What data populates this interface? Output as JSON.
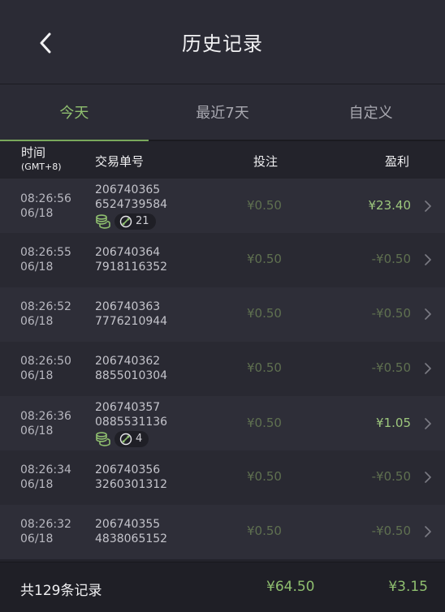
{
  "header": {
    "title": "历史记录",
    "back_icon": "chevron-left-icon"
  },
  "tabs": [
    {
      "label": "今天",
      "active": true
    },
    {
      "label": "最近7天",
      "active": false
    },
    {
      "label": "自定义",
      "active": false
    }
  ],
  "columns": {
    "time": "时间",
    "time_zone": "(GMT+8)",
    "order": "交易单号",
    "bet": "投注",
    "profit": "盈利"
  },
  "rows": [
    {
      "time": "08:26:56",
      "date": "06/18",
      "order1": "206740365",
      "order2": "6524739584",
      "bet": "¥0.50",
      "profit": "¥23.40",
      "win": true,
      "badge": "21"
    },
    {
      "time": "08:26:55",
      "date": "06/18",
      "order1": "206740364",
      "order2": "7918116352",
      "bet": "¥0.50",
      "profit": "-¥0.50",
      "win": false
    },
    {
      "time": "08:26:52",
      "date": "06/18",
      "order1": "206740363",
      "order2": "7776210944",
      "bet": "¥0.50",
      "profit": "-¥0.50",
      "win": false
    },
    {
      "time": "08:26:50",
      "date": "06/18",
      "order1": "206740362",
      "order2": "8855010304",
      "bet": "¥0.50",
      "profit": "-¥0.50",
      "win": false
    },
    {
      "time": "08:26:36",
      "date": "06/18",
      "order1": "206740357",
      "order2": "0885531136",
      "bet": "¥0.50",
      "profit": "¥1.05",
      "win": true,
      "badge": "4"
    },
    {
      "time": "08:26:34",
      "date": "06/18",
      "order1": "206740356",
      "order2": "3260301312",
      "bet": "¥0.50",
      "profit": "-¥0.50",
      "win": false
    },
    {
      "time": "08:26:32",
      "date": "06/18",
      "order1": "206740355",
      "order2": "4838065152",
      "bet": "¥0.50",
      "profit": "-¥0.50",
      "win": false
    }
  ],
  "footer": {
    "total_label": "共129条记录",
    "total_bet": "¥64.50",
    "total_profit": "¥3.15"
  },
  "colors": {
    "accent": "#8fbf6f",
    "win": "#9dc77d",
    "muted_green": "#5f7050"
  }
}
